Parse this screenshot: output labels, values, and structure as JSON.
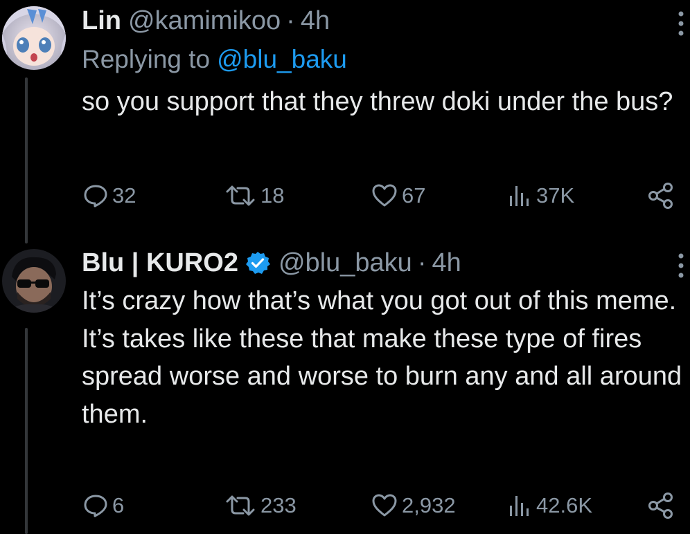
{
  "tweets": [
    {
      "name": "Lin",
      "handle": "@kamimikoo",
      "dot": "·",
      "time": "4h",
      "verified": false,
      "replying_prefix": "Replying to",
      "replying_to": "@blu_baku",
      "body": "so you support that they threw doki under the bus?",
      "actions": {
        "replies": "32",
        "retweets": "18",
        "likes": "67",
        "views": "37K"
      }
    },
    {
      "name": "Blu | KURO2",
      "handle": "@blu_baku",
      "dot": "·",
      "time": "4h",
      "verified": true,
      "body": "It’s crazy how that’s what you got out of this meme.\nIt’s takes like these that make these type of fires spread worse and worse to burn any and all around them.",
      "body_lines": [
        "It’s crazy how that’s what you got out of this meme.",
        "It’s takes like these that make these type of fires spread worse and worse to burn any and all around them."
      ],
      "actions": {
        "replies": "6",
        "retweets": "233",
        "likes": "2,932",
        "views": "42.6K"
      }
    }
  ],
  "icons": {
    "more": "more-vertical-icon",
    "reply": "reply-bubble-icon",
    "retweet": "retweet-icon",
    "like": "heart-icon",
    "views": "views-bar-chart-icon",
    "share": "share-icon",
    "verified": "verified-badge-icon"
  },
  "colors": {
    "background": "#000000",
    "text_primary": "#e7e9ea",
    "text_secondary": "#8b98a5",
    "link": "#1d9bf0",
    "verified": "#1d9bf0",
    "thread_line": "#333639"
  }
}
